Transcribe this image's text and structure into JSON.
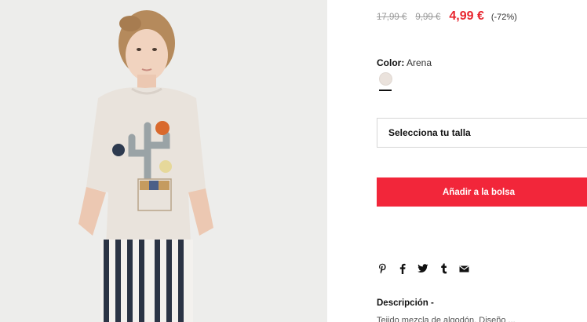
{
  "product": {
    "image_alt": "Niña con camiseta de cactus",
    "prices": {
      "original": "17,99 €",
      "previous": "9,99 €",
      "current": "4,99 €",
      "discount": "(-72%)"
    },
    "color": {
      "label": "Color:",
      "value": "Arena",
      "swatch_hex": "#eae2dc"
    },
    "size_select": {
      "placeholder": "Selecciona tu talla"
    },
    "add_to_bag": "Añadir a la bolsa",
    "share_icons": [
      "pinterest-icon",
      "facebook-icon",
      "twitter-icon",
      "tumblr-icon",
      "email-icon"
    ],
    "description": {
      "title": "Descripción -",
      "text": "Tejido mezcla de algodón. Diseño ...",
      "visible_text": "Tejido mezcla de algodón. Diseño ...",
      "full_text_visible": "Tejido mezcla de algodón. Diseño ...",
      "shown": "Tejido mezcla de algodón. Diseño ..."
    }
  },
  "colors": {
    "accent_red": "#f2263a",
    "price_red": "#e8262f",
    "border": "#d6d6d6"
  }
}
